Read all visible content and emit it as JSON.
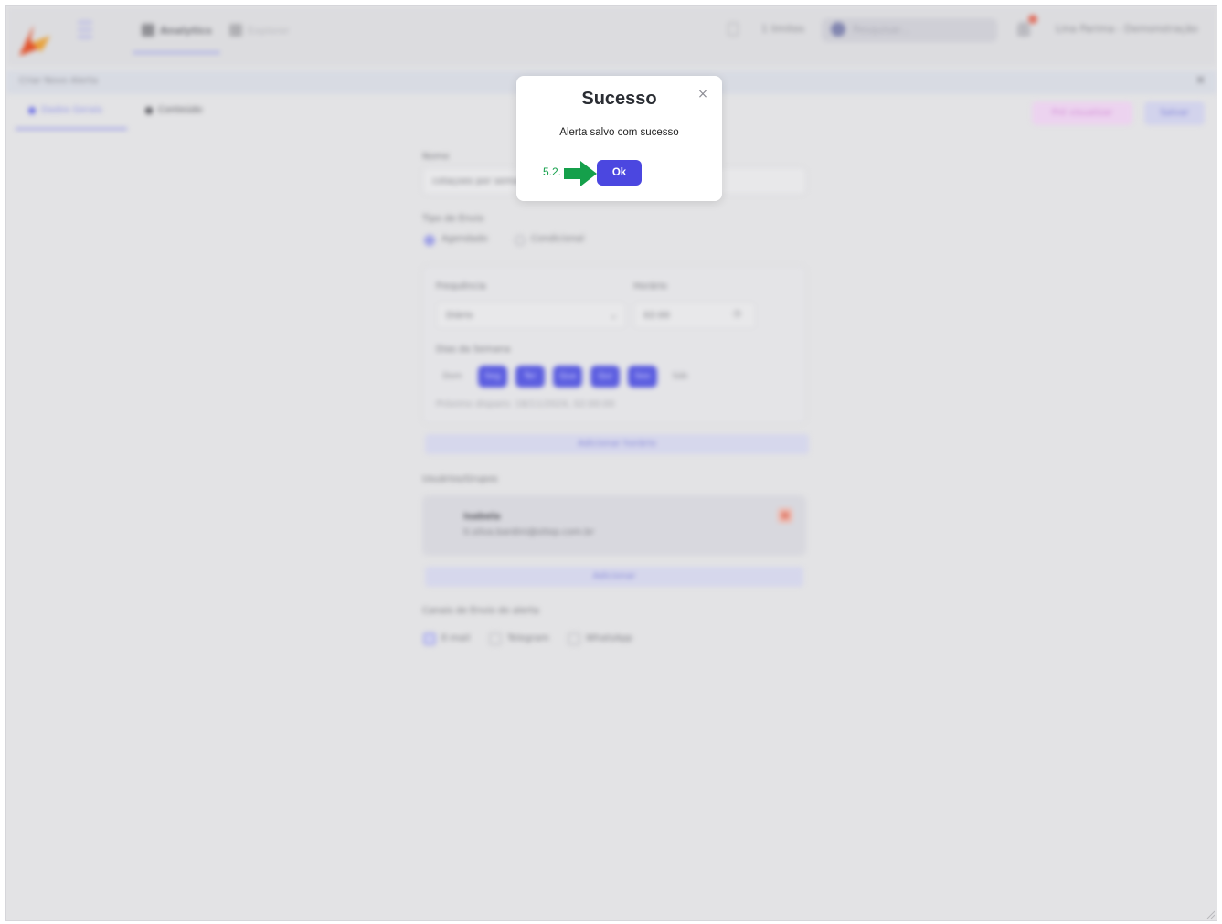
{
  "top_nav": {
    "tab_analytics": "Analytics",
    "tab_explorer": "Explorer",
    "clock_text": "1 limites",
    "search_placeholder": "Pesquisar...",
    "user_text": "Lina Parima - Demonstração"
  },
  "create_dialog": {
    "title": "Criar Novo Alerta",
    "tab_basic": "Dados Gerais",
    "tab_content": "Conteúdo",
    "btn_preview": "Pré visualizar",
    "btn_save": "Salvar",
    "name_label": "Nome",
    "name_value": "cotaçoes por semana",
    "send_type_label": "Tipo de Envio",
    "send_type_options": [
      "Agendado",
      "Condicional"
    ],
    "frequency_label": "Frequência",
    "frequency_value": "Diário",
    "time_label": "Horário",
    "time_value": "02:00",
    "weekdays_label": "Dias da Semana",
    "weekdays": [
      {
        "label": "Dom",
        "active": false
      },
      {
        "label": "Seg",
        "active": true
      },
      {
        "label": "Ter",
        "active": true
      },
      {
        "label": "Qua",
        "active": true
      },
      {
        "label": "Qui",
        "active": true
      },
      {
        "label": "Sex",
        "active": true
      },
      {
        "label": "Sáb",
        "active": false
      }
    ],
    "next_send": "Próximo disparo: 18/11/2024, 02:00:00",
    "add_time": "Adicionar horário",
    "recipients_label": "Usuários/Grupos",
    "recipient_name": "Isabela",
    "recipient_email": "ti.silva.bardini@sitep.com.br",
    "add_recipient": "Adicionar",
    "channels_label": "Canais de Envio do alerta",
    "channels": [
      "E-mail",
      "Telegram",
      "WhatsApp"
    ]
  },
  "modal": {
    "title": "Sucesso",
    "message": "Alerta salvo com sucesso",
    "ok_label": "Ok",
    "close_symbol": "×"
  },
  "annotation": {
    "step_label": "5.2.",
    "arrow_color": "#15a04b"
  },
  "colors": {
    "accent": "#4b47e0",
    "annotation": "#15a04b"
  }
}
